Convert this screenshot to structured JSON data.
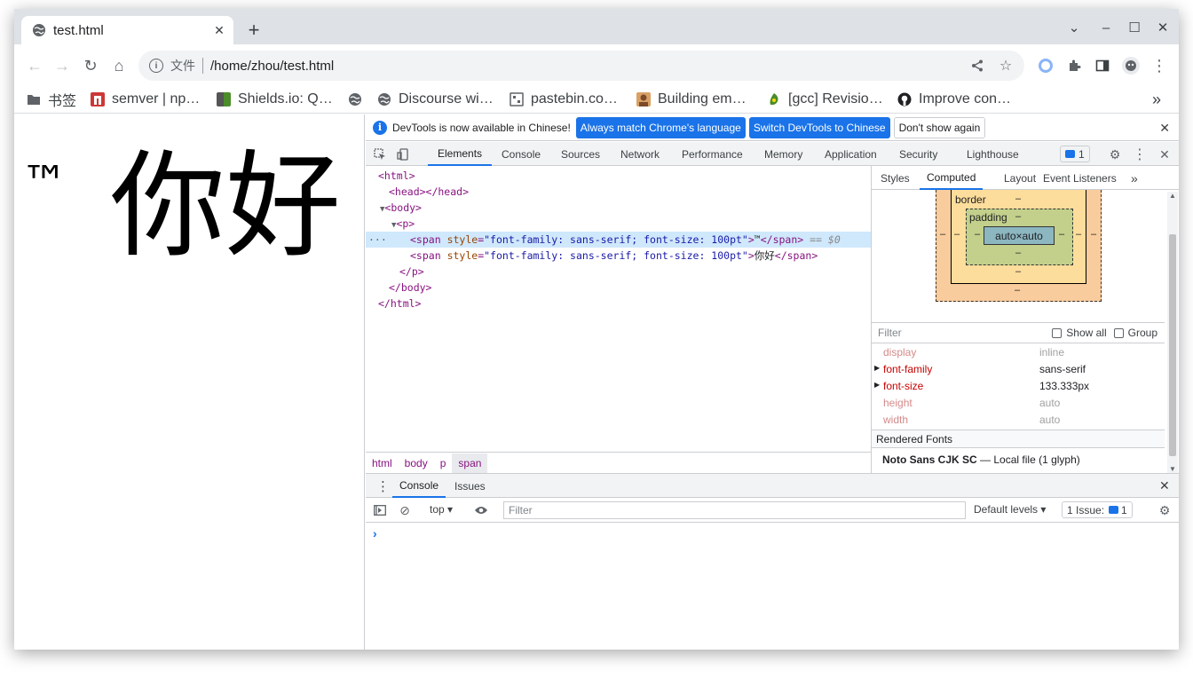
{
  "tab": {
    "title": "test.html"
  },
  "toolbar": {
    "scheme": "文件",
    "url": "/home/zhou/test.html"
  },
  "bookmarks": [
    {
      "label": "书签",
      "icon": "folder-icon",
      "color": "#5f6368"
    },
    {
      "label": "semver | np…",
      "icon": "npm-icon",
      "color": "#cb3837"
    },
    {
      "label": "Shields.io: Q…",
      "icon": "shields-icon",
      "color": "#4c8c2a"
    },
    {
      "label": "",
      "icon": "globe-icon",
      "color": "#5f6368"
    },
    {
      "label": "Discourse wi…",
      "icon": "globe-icon",
      "color": "#5f6368"
    },
    {
      "label": "pastebin.co…",
      "icon": "pastebin-icon",
      "color": "#5f6368"
    },
    {
      "label": "Building em…",
      "icon": "avatar-icon",
      "color": "#b5651d"
    },
    {
      "label": "[gcc] Revisio…",
      "icon": "gcc-icon",
      "color": "#4c8c2a"
    },
    {
      "label": "Improve con…",
      "icon": "github-icon",
      "color": "#202124"
    }
  ],
  "page": {
    "tm": "™",
    "cjk": "你好"
  },
  "devtools": {
    "infobar": {
      "message": "DevTools is now available in Chinese!",
      "btn_match": "Always match Chrome's language",
      "btn_switch": "Switch DevTools to Chinese",
      "btn_dont": "Don't show again"
    },
    "tabs": [
      "Elements",
      "Console",
      "Sources",
      "Network",
      "Performance",
      "Memory",
      "Application",
      "Security",
      "Lighthouse"
    ],
    "issue_count": "1",
    "tree": {
      "html_open": "<html>",
      "head": "<head></head>",
      "body_open": "<body>",
      "p_open": "<p>",
      "span_style_attr": "style",
      "span_style_val": "\"font-family: sans-serif; font-size: 100pt\"",
      "span1_text": "™",
      "span2_text": "你好",
      "eq": "== $0",
      "p_close": "</p>",
      "body_close": "</body>",
      "html_close": "</html>"
    },
    "breadcrumb": [
      "html",
      "body",
      "p",
      "span"
    ],
    "side_tabs": [
      "Styles",
      "Computed",
      "Layout",
      "Event Listeners"
    ],
    "boxmodel": {
      "border": "border",
      "padding": "padding",
      "content": "auto×auto",
      "dash": "–"
    },
    "filter": {
      "placeholder": "Filter",
      "show_all": "Show all",
      "group": "Group"
    },
    "props": [
      {
        "name": "display",
        "value": "inline",
        "strong": false
      },
      {
        "name": "font-family",
        "value": "sans-serif",
        "strong": true
      },
      {
        "name": "font-size",
        "value": "133.333px",
        "strong": true
      },
      {
        "name": "height",
        "value": "auto",
        "strong": false
      },
      {
        "name": "width",
        "value": "auto",
        "strong": false
      }
    ],
    "rendered_fonts": {
      "heading": "Rendered Fonts",
      "font": "Noto Sans CJK SC",
      "dash": "—",
      "source": "Local file (1 glyph)"
    },
    "drawer": {
      "tabs": [
        "Console",
        "Issues"
      ],
      "context": "top",
      "filter_placeholder": "Filter",
      "levels": "Default levels",
      "issues_label": "1 Issue:",
      "issues_count": "1"
    }
  }
}
